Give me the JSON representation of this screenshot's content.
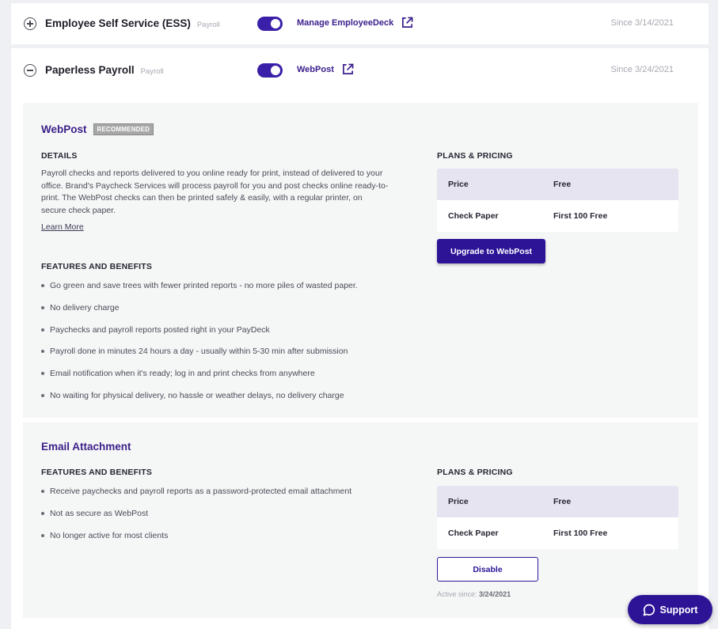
{
  "rows": [
    {
      "title": "Employee Self Service (ESS)",
      "category": "Payroll",
      "enabled": true,
      "link_label": "Manage EmployeeDeck",
      "since": "Since 3/14/2021",
      "expanded": false
    },
    {
      "title": "Paperless Payroll",
      "category": "Payroll",
      "enabled": true,
      "link_label": "WebPost",
      "since": "Since 3/24/2021",
      "expanded": true
    }
  ],
  "webpost": {
    "title": "WebPost",
    "badge": "RECOMMENDED",
    "details_heading": "DETAILS",
    "details_text": "Payroll checks and reports delivered to you online ready for print, instead of delivered to your office. Brand's Paycheck Services will process payroll for you and post checks online ready-to-print. The WebPost checks can then be printed safely & easily, with a regular printer, on secure check paper.",
    "learn_more": "Learn More",
    "features_heading": "FEATURES AND BENEFITS",
    "features": [
      "Go green and save trees with fewer printed reports - no more piles of wasted paper.",
      "No delivery charge",
      "Paychecks and payroll reports posted right in your PayDeck",
      "Payroll done in minutes 24 hours a day - usually within 5-30 min after submission",
      "Email notification when it's ready; log in and print checks from anywhere",
      "No waiting for physical delivery, no hassle or weather delays, no delivery charge"
    ],
    "pricing_heading": "PLANS & PRICING",
    "pricing": {
      "head": [
        "Price",
        "Free"
      ],
      "row": [
        "Check Paper",
        "First 100 Free"
      ]
    },
    "button": "Upgrade to WebPost"
  },
  "email_attachment": {
    "title": "Email Attachment",
    "features_heading": "FEATURES AND BENEFITS",
    "features": [
      "Receive paychecks and payroll reports as a password-protected email attachment",
      "Not as secure as WebPost",
      "No longer active for most clients"
    ],
    "pricing_heading": "PLANS & PRICING",
    "pricing": {
      "head": [
        "Price",
        "Free"
      ],
      "row": [
        "Check Paper",
        "First 100 Free"
      ]
    },
    "button": "Disable",
    "active_since_label": "Active since:",
    "active_since_date": "3/24/2021"
  },
  "support_label": "Support",
  "colors": {
    "accent": "#2d1497",
    "toggle_on": "#3a1fa8",
    "title_purple": "#3b1f88",
    "table_head": "#e6e4f1"
  }
}
